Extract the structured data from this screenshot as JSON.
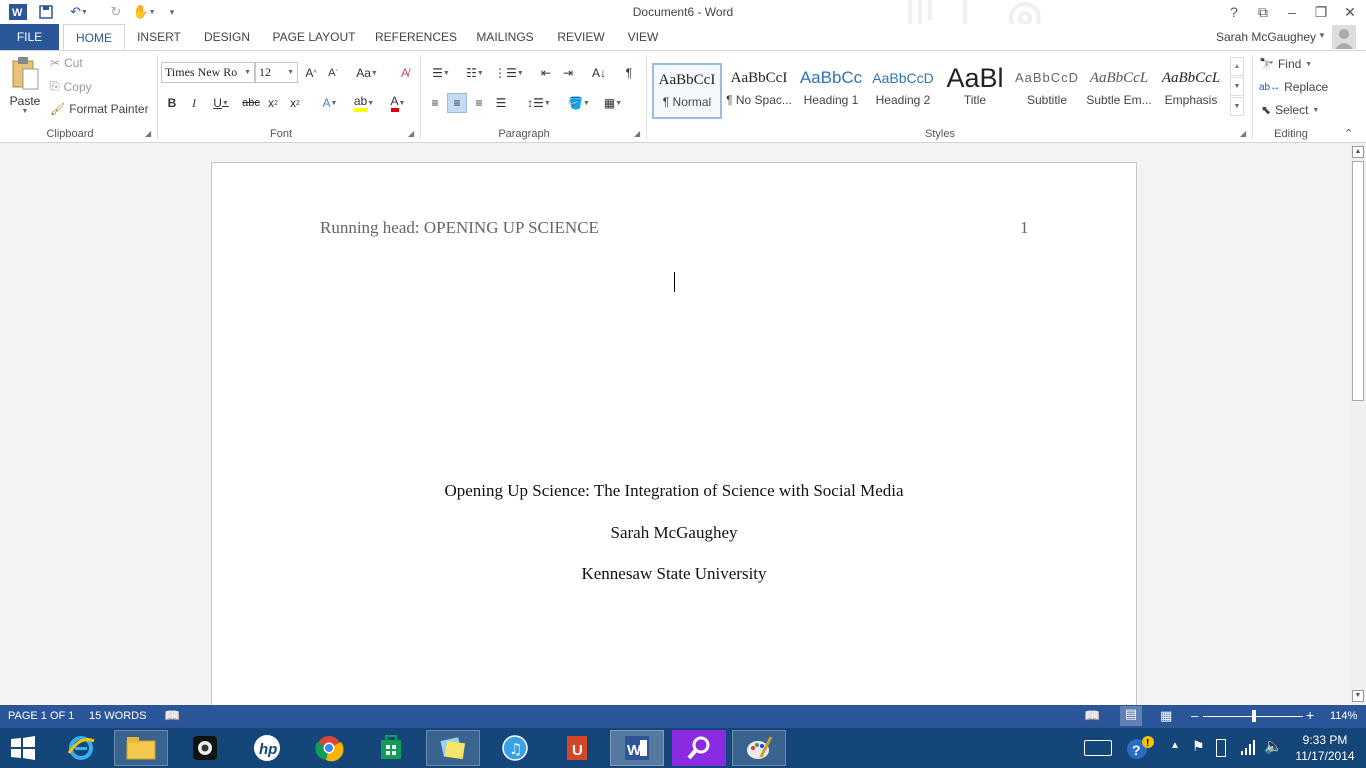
{
  "window": {
    "title": "Document6 - Word",
    "help": "?",
    "user": "Sarah McGaughey"
  },
  "tabs": [
    "FILE",
    "HOME",
    "INSERT",
    "DESIGN",
    "PAGE LAYOUT",
    "REFERENCES",
    "MAILINGS",
    "REVIEW",
    "VIEW"
  ],
  "ribbon": {
    "clipboard": {
      "label": "Clipboard",
      "paste": "Paste",
      "cut": "Cut",
      "copy": "Copy",
      "format_painter": "Format Painter"
    },
    "font": {
      "label": "Font",
      "family": "Times New Ro",
      "size": "12"
    },
    "paragraph": {
      "label": "Paragraph"
    },
    "styles": {
      "label": "Styles",
      "items": [
        {
          "preview": "AaBbCcI",
          "name": "¶ Normal"
        },
        {
          "preview": "AaBbCcI",
          "name": "¶ No Spac..."
        },
        {
          "preview": "AaBbCc",
          "name": "Heading 1"
        },
        {
          "preview": "AaBbCcD",
          "name": "Heading 2"
        },
        {
          "preview": "AaBl",
          "name": "Title"
        },
        {
          "preview": "AaBbCcD",
          "name": "Subtitle"
        },
        {
          "preview": "AaBbCcL",
          "name": "Subtle Em..."
        },
        {
          "preview": "AaBbCcL",
          "name": "Emphasis"
        }
      ]
    },
    "editing": {
      "label": "Editing",
      "find": "Find",
      "replace": "Replace",
      "select": "Select"
    }
  },
  "document": {
    "running_head": "Running head: OPENING UP SCIENCE",
    "page_number": "1",
    "title": "Opening Up Science: The Integration of Science with Social Media",
    "author": "Sarah McGaughey",
    "institution": "Kennesaw State University"
  },
  "status": {
    "page": "PAGE 1 OF 1",
    "words": "15 WORDS",
    "zoom": "114%"
  },
  "taskbar": {
    "time": "9:33 PM",
    "date": "11/17/2014"
  }
}
